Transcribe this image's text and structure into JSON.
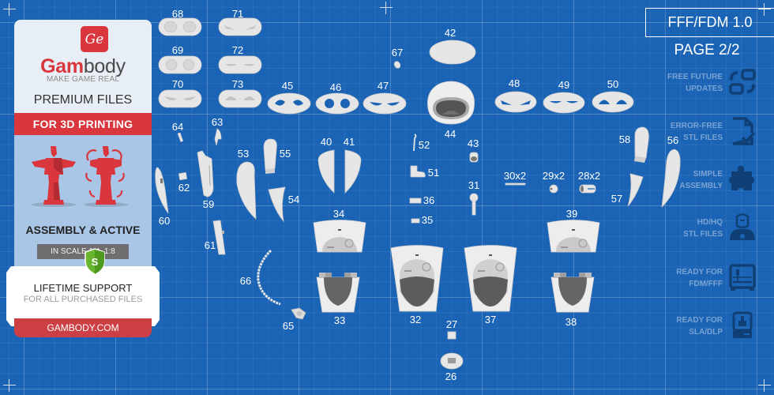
{
  "brand": {
    "logo_mark": "Ge",
    "name_part1": "Gam",
    "name_part2": "body",
    "tagline": "MAKE GAME REAL",
    "accent_color": "#d9363e"
  },
  "left_panel": {
    "premium_label": "PREMIUM FILES",
    "print_banner": "FOR 3D PRINTING",
    "assembly_label": "ASSEMBLY & ACTIVE",
    "scale_label": "IN SCALE 1:4, 1:8",
    "support_badge_letter": "S",
    "support_title": "LIFETIME SUPPORT",
    "support_subtitle": "FOR ALL PURCHASED FILES",
    "website": "GAMBODY.COM"
  },
  "header": {
    "format_label": "FFF/FDM 1.0",
    "page_label": "PAGE 2/2"
  },
  "features": [
    {
      "line1": "FREE FUTURE",
      "line2": "UPDATES",
      "icon": "update-arrows-icon"
    },
    {
      "line1": "ERROR-FREE",
      "line2": "STL FILES",
      "icon": "file-check-icon"
    },
    {
      "line1": "SIMPLE",
      "line2": "ASSEMBLY",
      "icon": "puzzle-icon"
    },
    {
      "line1": "HD/HQ",
      "line2": "STL FILES",
      "icon": "figure-bust-icon"
    },
    {
      "line1": "READY FOR",
      "line2": "FDM/FFF",
      "icon": "fdm-printer-icon"
    },
    {
      "line1": "READY FOR",
      "line2": "SLA/DLP",
      "icon": "sla-printer-icon"
    }
  ],
  "colors": {
    "blueprint_bg": "#1a63b5",
    "part_white": "#e6e6e6",
    "feature_text": "#7aa3d3",
    "feature_icon": "#0f3f74"
  },
  "parts": {
    "p68": "68",
    "p71": "71",
    "p69": "69",
    "p72": "72",
    "p70": "70",
    "p73": "73",
    "p45": "45",
    "p46": "46",
    "p47": "47",
    "p67": "67",
    "p42": "42",
    "p44": "44",
    "p48": "48",
    "p49": "49",
    "p50": "50",
    "p64": "64",
    "p63": "63",
    "p62": "62",
    "p59": "59",
    "p60": "60",
    "p61": "61",
    "p53": "53",
    "p55": "55",
    "p54": "54",
    "p40": "40",
    "p41": "41",
    "p52": "52",
    "p51": "51",
    "p36": "36",
    "p35": "35",
    "p43": "43",
    "p31": "31",
    "p30": "30x2",
    "p29": "29x2",
    "p28": "28x2",
    "p58": "58",
    "p56": "56",
    "p57": "57",
    "p34": "34",
    "p39": "39",
    "p66": "66",
    "p65": "65",
    "p33": "33",
    "p32": "32",
    "p37": "37",
    "p38": "38",
    "p27": "27",
    "p26": "26"
  }
}
